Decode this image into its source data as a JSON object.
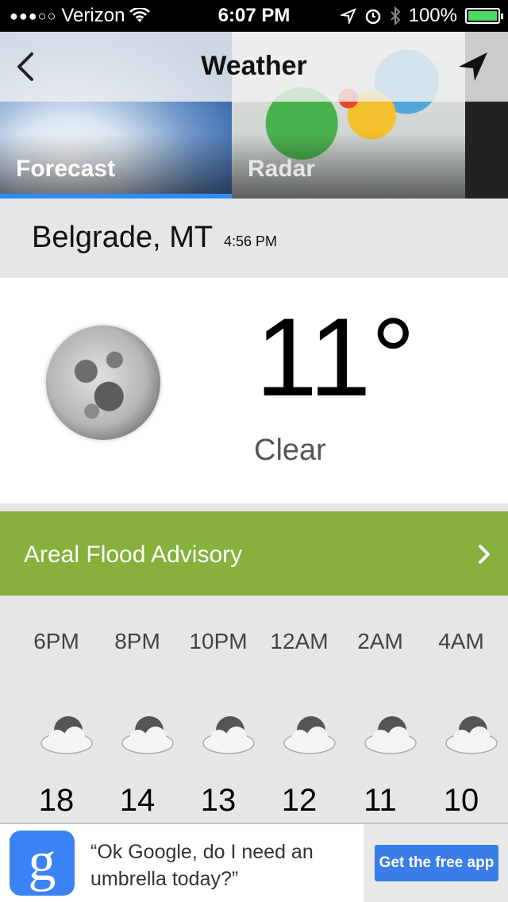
{
  "status_bar": {
    "carrier": "Verizon",
    "signal_dots": "●●●○○",
    "time": "6:07 PM",
    "battery": "100%"
  },
  "nav": {
    "title": "Weather",
    "back_icon": "chevron-left-icon",
    "location_icon": "location-arrow-icon"
  },
  "tabs": [
    {
      "label": "Forecast",
      "selected": true
    },
    {
      "label": "Radar",
      "selected": false
    }
  ],
  "location": {
    "city": "Belgrade, MT",
    "updated": "4:56 PM"
  },
  "current": {
    "temperature": "11°",
    "condition": "Clear",
    "icon": "moon-icon"
  },
  "advisory": {
    "label": "Areal Flood Advisory",
    "color": "#87b03c"
  },
  "hourly": [
    {
      "time": "6PM",
      "temp": "18",
      "icon": "cloud-moon-icon"
    },
    {
      "time": "8PM",
      "temp": "14",
      "icon": "cloud-moon-icon"
    },
    {
      "time": "10PM",
      "temp": "13",
      "icon": "cloud-moon-icon"
    },
    {
      "time": "12AM",
      "temp": "12",
      "icon": "cloud-moon-icon"
    },
    {
      "time": "2AM",
      "temp": "11",
      "icon": "cloud-moon-icon"
    },
    {
      "time": "4AM",
      "temp": "10",
      "icon": "cloud-moon-icon"
    }
  ],
  "ad": {
    "logo": "g",
    "text": "“Ok Google, do I need an umbrella today?”",
    "cta": "Get the free app"
  }
}
